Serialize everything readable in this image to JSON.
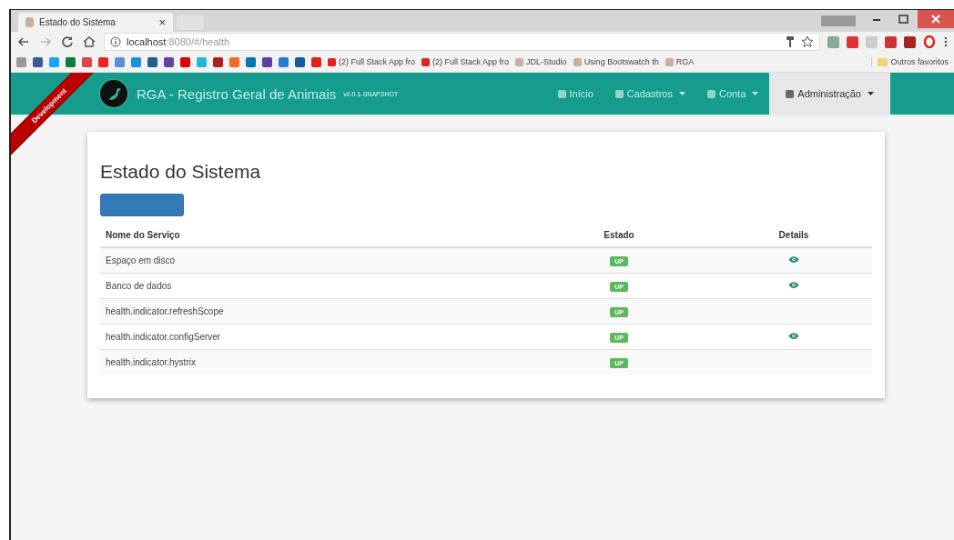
{
  "browser": {
    "tab": {
      "title": "Estado do Sistema",
      "close": "×"
    },
    "url": {
      "host": "localhost",
      "path": ":8080/#/health"
    },
    "bookmarks": [
      {
        "label": "(2) Full Stack App fro"
      },
      {
        "label": "(2) Full Stack App fro"
      },
      {
        "label": "JDL-Studio"
      },
      {
        "label": "Using Bootswatch th"
      },
      {
        "label": "RGA"
      }
    ],
    "other_bookmarks": "Outros favoritos"
  },
  "ribbon": "Development",
  "navbar": {
    "brand": "RGA - Registro Geral de Animais",
    "version": "v0.0.1-SNAPSHOT",
    "items": [
      {
        "label": "Início",
        "selected": false,
        "dropdown": false
      },
      {
        "label": "Cadastros",
        "selected": false,
        "dropdown": true
      },
      {
        "label": "Conta",
        "selected": false,
        "dropdown": true
      },
      {
        "label": "Administração",
        "selected": true,
        "dropdown": true
      }
    ]
  },
  "page": {
    "title": "Estado do Sistema",
    "table": {
      "columns": [
        "Nome do Serviço",
        "Estado",
        "Details"
      ],
      "rows": [
        {
          "name": "Espaço em disco",
          "status": "UP",
          "details": true
        },
        {
          "name": "Banco de dados",
          "status": "UP",
          "details": true
        },
        {
          "name": "health.indicator.refreshScope",
          "status": "UP",
          "details": false
        },
        {
          "name": "health.indicator.configServer",
          "status": "UP",
          "details": true
        },
        {
          "name": "health.indicator.hystrix",
          "status": "UP",
          "details": false
        }
      ]
    }
  }
}
